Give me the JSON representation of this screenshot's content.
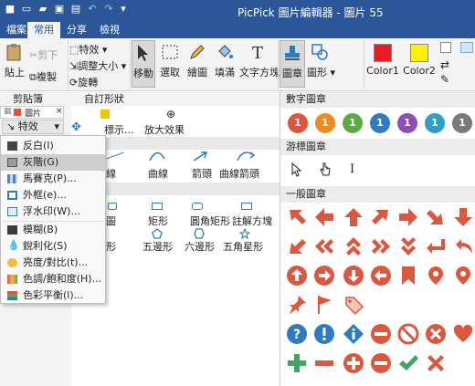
{
  "window": {
    "title": "PicPick 圖片編輯器 - 圖片 55"
  },
  "menu": {
    "tabs": [
      "檔案",
      "常用",
      "分享",
      "檢視"
    ],
    "active": "常用"
  },
  "ribbon": {
    "paste": "貼上",
    "cut": "剪下",
    "copy": "複製",
    "clipboard_group": "剪貼簿",
    "effect": "特效",
    "resize": "調整大小",
    "rotate": "旋轉",
    "move": "移動",
    "select": "選取",
    "draw": "繪圖",
    "fill": "填滿",
    "textbox": "文字方塊",
    "stamp": "圖章",
    "shape": "圖形",
    "color1": "Color1",
    "color2": "Color2",
    "color1_hex": "#e81c24",
    "color2_hex": "#fff200"
  },
  "left": {
    "doc_tab": "圖片",
    "effect_button": "特效"
  },
  "dropdown": [
    {
      "label": "反白(I)",
      "icon": "invert-icon"
    },
    {
      "label": "灰階(G)",
      "icon": "grayscale-icon",
      "highlighted": true
    },
    {
      "label": "馬賽克(P)...",
      "icon": "mosaic-icon"
    },
    {
      "label": "外框(e)...",
      "icon": "frame-icon"
    },
    {
      "label": "浮水印(W)...",
      "icon": "watermark-icon"
    },
    {
      "label": "模糊(B)",
      "icon": "blur-icon"
    },
    {
      "label": "銳利化(S)",
      "icon": "sharpen-icon"
    },
    {
      "label": "亮度/對比(t)...",
      "icon": "brightness-icon"
    },
    {
      "label": "色調/飽和度(H)...",
      "icon": "hue-icon"
    },
    {
      "label": "色彩平衡(l)...",
      "icon": "color-balance-icon"
    }
  ],
  "shapes": {
    "header": "自訂形狀",
    "row1": [
      "標示...",
      "放大效果"
    ],
    "row2": [
      "線",
      "曲線",
      "箭頭",
      "曲線箭頭"
    ],
    "row3": [
      "圖",
      "矩形",
      "圓角矩形",
      "註解方塊"
    ],
    "row4": [
      "形",
      "五邊形",
      "六邊形",
      "五角星形"
    ]
  },
  "stamps": {
    "number_header": "數字圖章",
    "cursor_header": "游標圖章",
    "general_header": "一般圖章",
    "numbers": [
      {
        "n": "1",
        "color": "#e0533f"
      },
      {
        "n": "1",
        "color": "#ef8b1e"
      },
      {
        "n": "1",
        "color": "#5ea846"
      },
      {
        "n": "1",
        "color": "#2f7bc1"
      },
      {
        "n": "1",
        "color": "#8d4fb3"
      },
      {
        "n": "1",
        "color": "#2f9fc4"
      },
      {
        "n": "1",
        "color": "#7a7a7a"
      }
    ],
    "stamp_color": "#d9583f",
    "info_color": "#2f7bc1",
    "ok_color": "#3fa561",
    "cursor_text": "I"
  }
}
